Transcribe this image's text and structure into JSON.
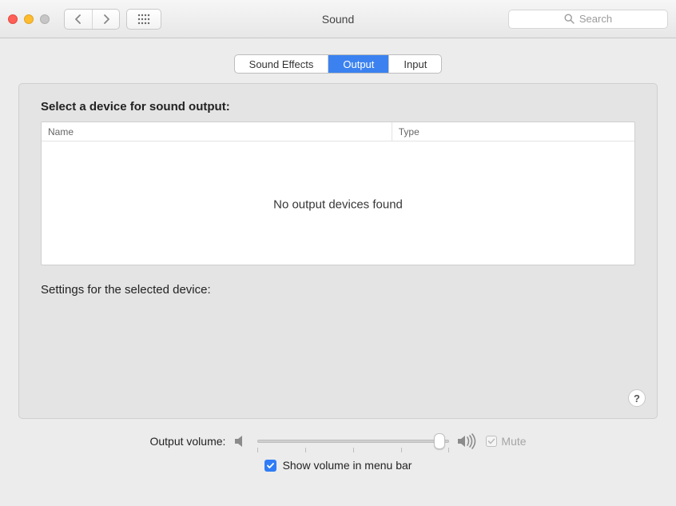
{
  "window": {
    "title": "Sound"
  },
  "toolbar": {
    "search_placeholder": "Search"
  },
  "tabs": {
    "items": [
      "Sound Effects",
      "Output",
      "Input"
    ],
    "active_index": 1,
    "active_bg": "#3b82f0"
  },
  "output_pane": {
    "select_label": "Select a device for sound output:",
    "columns": {
      "name": "Name",
      "type": "Type"
    },
    "devices": [],
    "empty_message": "No output devices found",
    "settings_label": "Settings for the selected device:"
  },
  "help": {
    "glyph": "?"
  },
  "volume": {
    "label": "Output volume:",
    "value": 0.95,
    "mute_label": "Mute",
    "mute_checked": false,
    "mute_enabled": false,
    "menubar_label": "Show volume in menu bar",
    "menubar_checked": true
  }
}
